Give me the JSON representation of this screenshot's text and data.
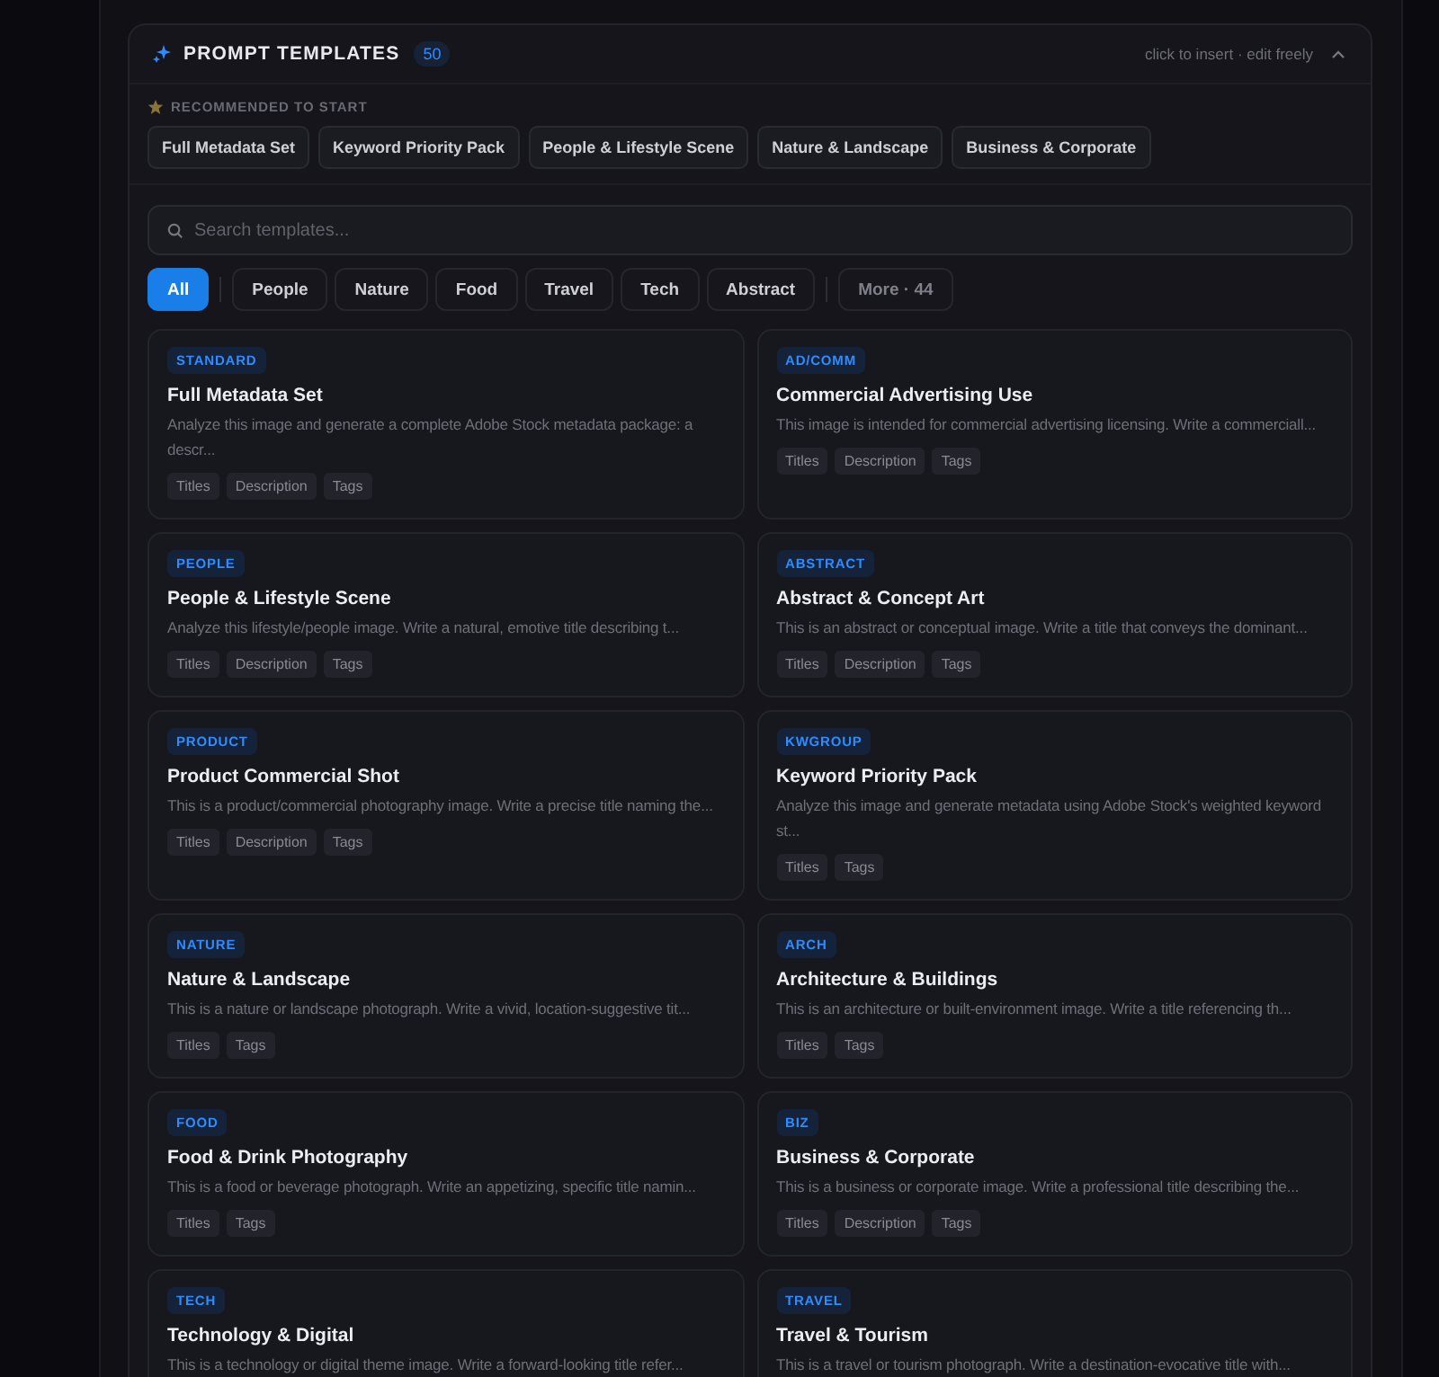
{
  "panel": {
    "title": "PROMPT TEMPLATES",
    "count": "50",
    "hint": "click to insert · edit freely"
  },
  "recommended": {
    "label": "RECOMMENDED TO START",
    "items": [
      "Full Metadata Set",
      "Keyword Priority Pack",
      "People & Lifestyle Scene",
      "Nature & Landscape",
      "Business & Corporate"
    ]
  },
  "search": {
    "placeholder": "Search templates..."
  },
  "filters": [
    {
      "label": "All",
      "selected": true
    },
    {
      "label": "People",
      "selected": false
    },
    {
      "label": "Nature",
      "selected": false
    },
    {
      "label": "Food",
      "selected": false
    },
    {
      "label": "Travel",
      "selected": false
    },
    {
      "label": "Tech",
      "selected": false
    },
    {
      "label": "Abstract",
      "selected": false
    }
  ],
  "more_button": "More · 44",
  "templates": [
    {
      "category": "STANDARD",
      "title": "Full Metadata Set",
      "description": "Analyze this image and generate a complete Adobe Stock metadata package: a descr...",
      "outputs": [
        "Titles",
        "Description",
        "Tags"
      ]
    },
    {
      "category": "AD/COMM",
      "title": "Commercial Advertising Use",
      "description": "This image is intended for commercial advertising licensing. Write a commerciall...",
      "outputs": [
        "Titles",
        "Description",
        "Tags"
      ]
    },
    {
      "category": "PEOPLE",
      "title": "People & Lifestyle Scene",
      "description": "Analyze this lifestyle/people image. Write a natural, emotive title describing t...",
      "outputs": [
        "Titles",
        "Description",
        "Tags"
      ]
    },
    {
      "category": "ABSTRACT",
      "title": "Abstract & Concept Art",
      "description": "This is an abstract or conceptual image. Write a title that conveys the dominant...",
      "outputs": [
        "Titles",
        "Description",
        "Tags"
      ]
    },
    {
      "category": "PRODUCT",
      "title": "Product Commercial Shot",
      "description": "This is a product/commercial photography image. Write a precise title naming the...",
      "outputs": [
        "Titles",
        "Description",
        "Tags"
      ]
    },
    {
      "category": "KWGROUP",
      "title": "Keyword Priority Pack",
      "description": "Analyze this image and generate metadata using Adobe Stock's weighted keyword st...",
      "outputs": [
        "Titles",
        "Tags"
      ]
    },
    {
      "category": "NATURE",
      "title": "Nature & Landscape",
      "description": "This is a nature or landscape photograph. Write a vivid, location-suggestive tit...",
      "outputs": [
        "Titles",
        "Tags"
      ]
    },
    {
      "category": "ARCH",
      "title": "Architecture & Buildings",
      "description": "This is an architecture or built-environment image. Write a title referencing th...",
      "outputs": [
        "Titles",
        "Tags"
      ]
    },
    {
      "category": "FOOD",
      "title": "Food & Drink Photography",
      "description": "This is a food or beverage photograph. Write an appetizing, specific title namin...",
      "outputs": [
        "Titles",
        "Tags"
      ]
    },
    {
      "category": "BIZ",
      "title": "Business & Corporate",
      "description": "This is a business or corporate image. Write a professional title describing the...",
      "outputs": [
        "Titles",
        "Description",
        "Tags"
      ]
    },
    {
      "category": "TECH",
      "title": "Technology & Digital",
      "description": "This is a technology or digital theme image. Write a forward-looking title refer..."
    },
    {
      "category": "TRAVEL",
      "title": "Travel & Tourism",
      "description": "This is a travel or tourism photograph. Write a destination-evocative title with..."
    }
  ]
}
